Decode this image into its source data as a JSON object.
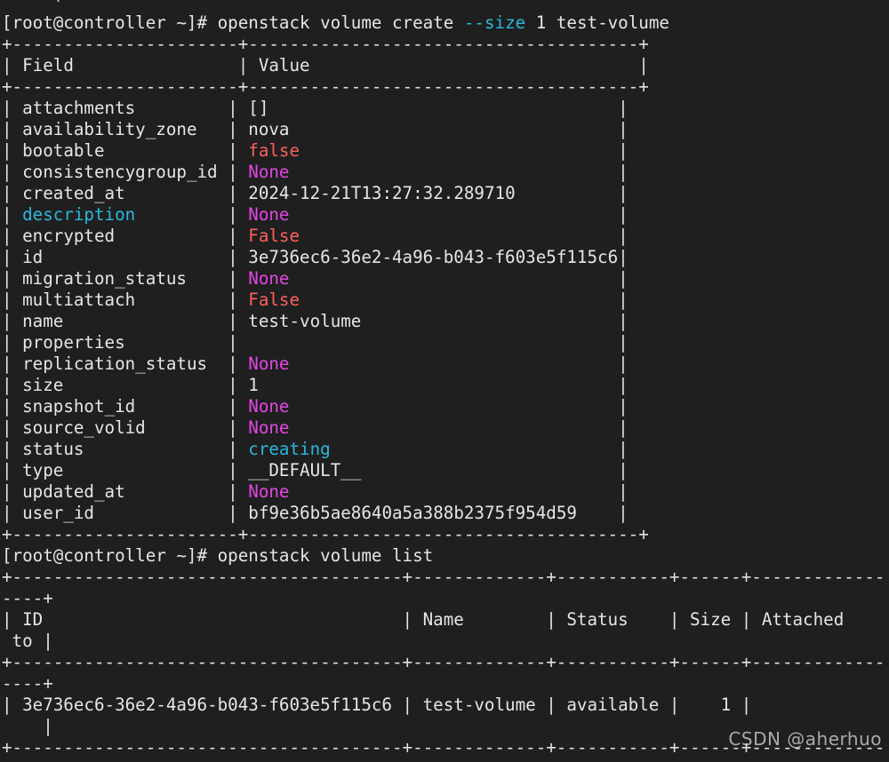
{
  "terminal": {
    "background_color": "#1f1f1f",
    "foreground_color": "#d8d8d8",
    "colors": {
      "cyan": "#29b8db",
      "magenta": "#e545e5",
      "red": "#ff5f5f",
      "white": "#e6e6e6"
    },
    "prompt": "[root@controller ~]#",
    "scrollback_fragment": "-----+",
    "commands": [
      "openstack volume create --size 1 test-volume",
      "openstack volume list"
    ],
    "command1": {
      "base": "openstack volume create",
      "flag": "--size",
      "flag_value": "1",
      "argument": "test-volume"
    },
    "command2": {
      "base": "openstack volume list"
    }
  },
  "create_table": {
    "rule_top": "+----------------------+--------------------------------------+",
    "rule_mid": "+----------------------+--------------------------------------+",
    "rule_bottom": "+----------------------+--------------------------------------+",
    "headers": [
      "Field",
      "Value"
    ],
    "rows": [
      {
        "field": "attachments",
        "value": "[]",
        "color": "white"
      },
      {
        "field": "availability_zone",
        "value": "nova",
        "color": "white"
      },
      {
        "field": "bootable",
        "value": "false",
        "color": "red"
      },
      {
        "field": "consistencygroup_id",
        "value": "None",
        "color": "magenta"
      },
      {
        "field": "created_at",
        "value": "2024-12-21T13:27:32.289710",
        "color": "white"
      },
      {
        "field": "description",
        "value": "None",
        "color": "magenta",
        "field_color": "cyan"
      },
      {
        "field": "encrypted",
        "value": "False",
        "color": "red"
      },
      {
        "field": "id",
        "value": "3e736ec6-36e2-4a96-b043-f603e5f115c6",
        "color": "white"
      },
      {
        "field": "migration_status",
        "value": "None",
        "color": "magenta"
      },
      {
        "field": "multiattach",
        "value": "False",
        "color": "red"
      },
      {
        "field": "name",
        "value": "test-volume",
        "color": "white"
      },
      {
        "field": "properties",
        "value": "",
        "color": "white"
      },
      {
        "field": "replication_status",
        "value": "None",
        "color": "magenta"
      },
      {
        "field": "size",
        "value": "1",
        "color": "white"
      },
      {
        "field": "snapshot_id",
        "value": "None",
        "color": "magenta"
      },
      {
        "field": "source_volid",
        "value": "None",
        "color": "magenta"
      },
      {
        "field": "status",
        "value": "creating",
        "color": "cyan"
      },
      {
        "field": "type",
        "value": "__DEFAULT__",
        "color": "white"
      },
      {
        "field": "updated_at",
        "value": "None",
        "color": "magenta"
      },
      {
        "field": "user_id",
        "value": "bf9e36b5ae8640a5a388b2375f954d59",
        "color": "white"
      }
    ]
  },
  "list_table": {
    "rule_a": "+--------------------------------------+-------------+-----------+------+-------------",
    "rule_a_wrap": "----+",
    "header_line": "| ID                                   | Name        | Status    | Size | Attached",
    "header_wrap": " to |",
    "headers": [
      "ID",
      "Name",
      "Status",
      "Size",
      "Attached to"
    ],
    "rule_b": "+--------------------------------------+-------------+-----------+------+-------------",
    "rule_b_wrap": "----+",
    "row_line": "| 3e736ec6-36e2-4a96-b043-f603e5f115c6 | test-volume | available |    1 |",
    "row_wrap": "    |",
    "rows": [
      {
        "id": "3e736ec6-36e2-4a96-b043-f603e5f115c6",
        "name": "test-volume",
        "status": "available",
        "size": "1",
        "attached_to": ""
      }
    ],
    "rule_c": "+--------------------------------------+-------------+-----------+------+-------------"
  },
  "watermark": {
    "text": "CSDN @aherhuo"
  }
}
